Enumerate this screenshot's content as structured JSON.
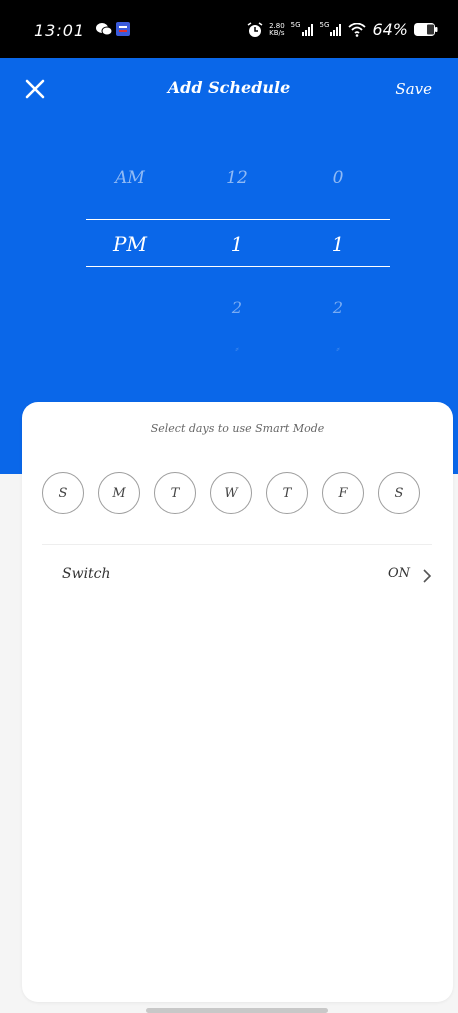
{
  "status": {
    "time": "13:01",
    "speed": "2.80",
    "speed_unit": "KB/s",
    "net1": "5G",
    "net2": "5G",
    "battery": "64%"
  },
  "header": {
    "title": "Add Schedule",
    "save_label": "Save"
  },
  "picker": {
    "period": {
      "above": "AM",
      "selected": "PM"
    },
    "hour": {
      "above": "12",
      "selected": "1",
      "below": "2"
    },
    "minute": {
      "above": "0",
      "selected": "1",
      "below": "2"
    }
  },
  "card": {
    "hint": "Select days to use Smart Mode",
    "days": [
      "S",
      "M",
      "T",
      "W",
      "T",
      "F",
      "S"
    ],
    "switch_label": "Switch",
    "switch_value": "ON"
  },
  "colors": {
    "primary": "#0a67e9",
    "background": "#f5f5f5",
    "card": "#ffffff"
  }
}
